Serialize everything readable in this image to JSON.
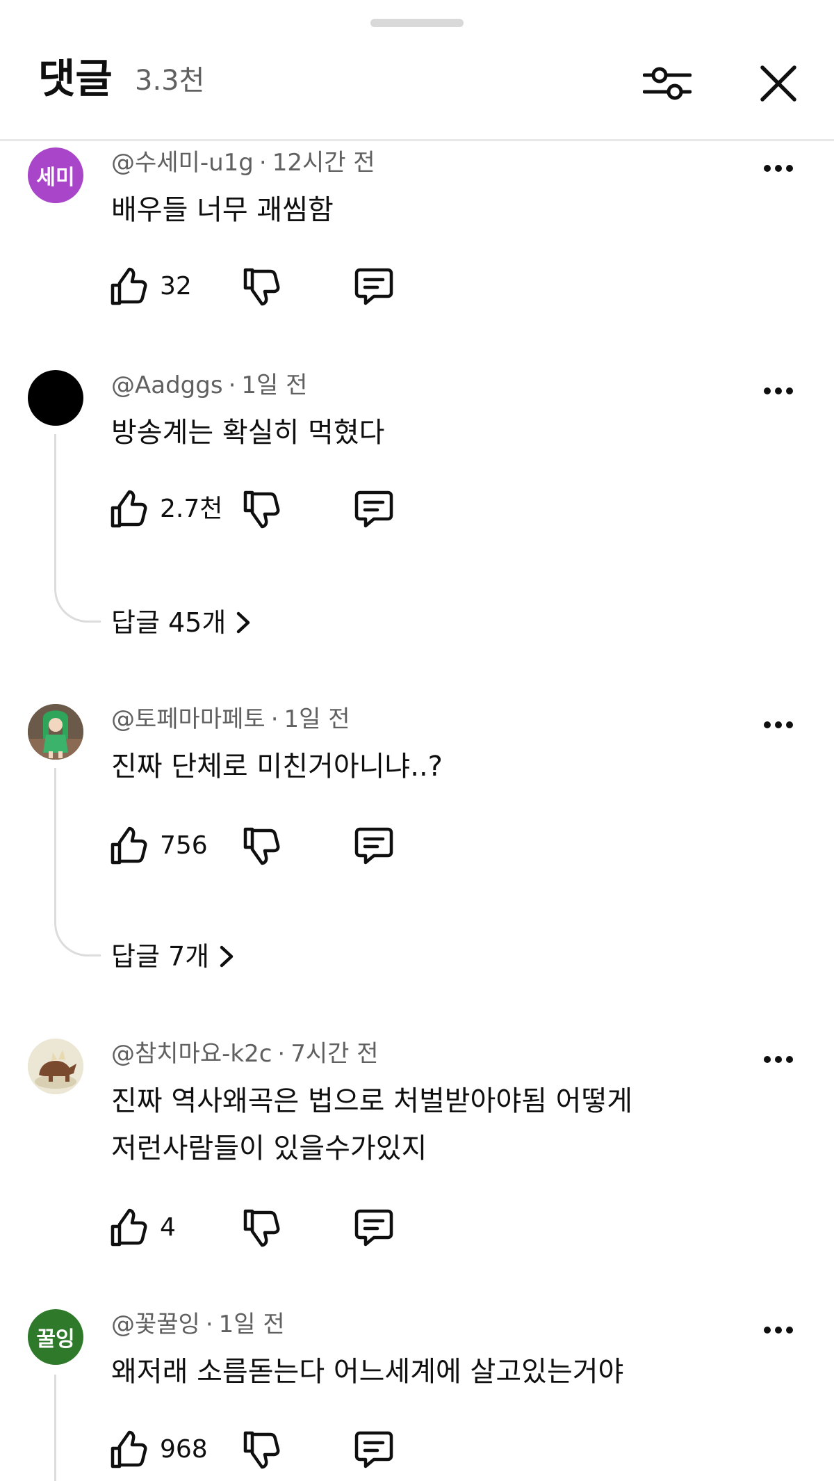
{
  "header": {
    "title": "댓글",
    "count": "3.3천"
  },
  "comments": [
    {
      "avatar_text": "세미",
      "avatar_color": "#a845c9",
      "author": "@수세미-u1g",
      "time": "12시간 전",
      "lines": [
        "배우들 너무 괘씸함"
      ],
      "likes": "32"
    },
    {
      "avatar_text": "",
      "avatar_color": "#000000",
      "author": "@Aadggs",
      "time": "1일 전",
      "lines": [
        "방송계는 확실히 먹혔다"
      ],
      "likes": "2.7천",
      "replies": "답글 45개"
    },
    {
      "avatar_text": "",
      "avatar_color": "#5a6b4a",
      "author": "@토페마마페토",
      "time": "1일 전",
      "lines": [
        "진짜 단체로 미친거아니냐..?"
      ],
      "likes": "756",
      "replies": "답글 7개"
    },
    {
      "avatar_text": "",
      "avatar_color": "#e8e2d0",
      "author": "@참치마요-k2c",
      "time": "7시간 전",
      "lines": [
        "진짜 역사왜곡은 법으로 처벌받아야됨 어떻게",
        "저런사람들이 있을수가있지"
      ],
      "likes": "4"
    },
    {
      "avatar_text": "꿀잉",
      "avatar_color": "#2f7a2a",
      "author": "@꽃꿀잉",
      "time": "1일 전",
      "lines": [
        "왜저래 소름돋는다 어느세계에 살고있는거야"
      ],
      "likes": "968"
    }
  ]
}
